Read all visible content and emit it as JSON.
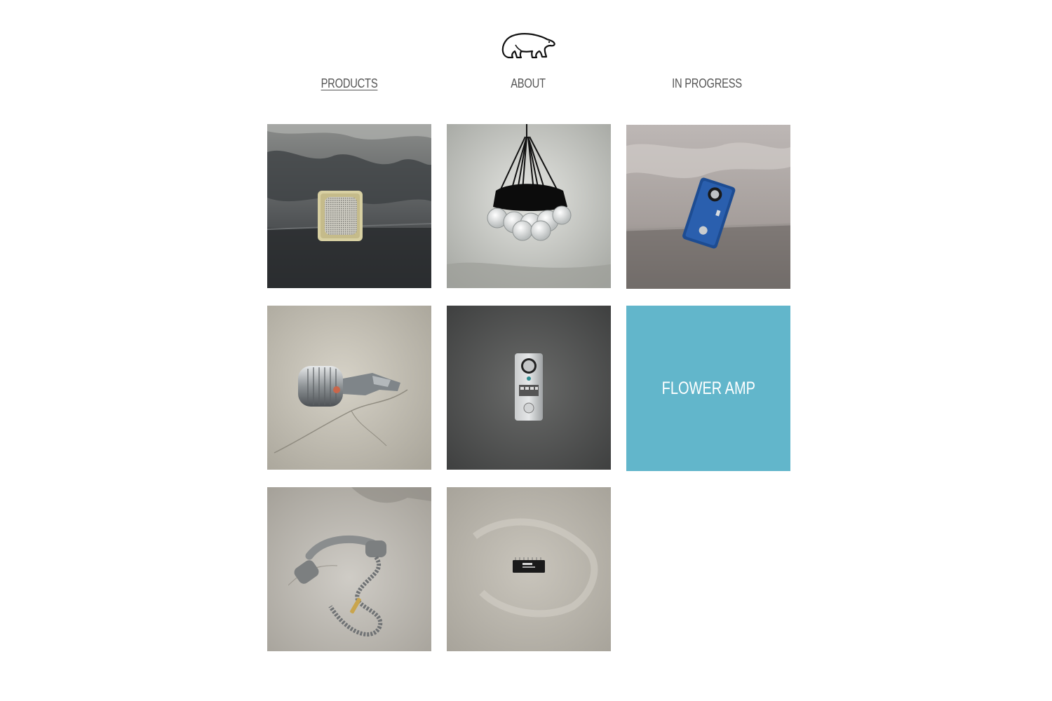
{
  "header": {
    "logo_icon": "polar-bear-icon"
  },
  "nav": {
    "items": [
      {
        "label": "PRODUCTS",
        "active": true
      },
      {
        "label": "ABOUT",
        "active": false
      },
      {
        "label": "IN PROGRESS",
        "active": false
      }
    ]
  },
  "grid": {
    "tiles": [
      {
        "image": "speaker-photo"
      },
      {
        "image": "bulb-chandelier-photo"
      },
      {
        "image": "blue-pedal-photo"
      },
      {
        "image": "microphone-photo"
      },
      {
        "image": "silver-pedal-photo"
      },
      {
        "label": "FLOWER AMP",
        "color": "#62b6cb"
      },
      {
        "image": "telephone-handset-photo"
      },
      {
        "image": "microchip-photo"
      }
    ]
  }
}
